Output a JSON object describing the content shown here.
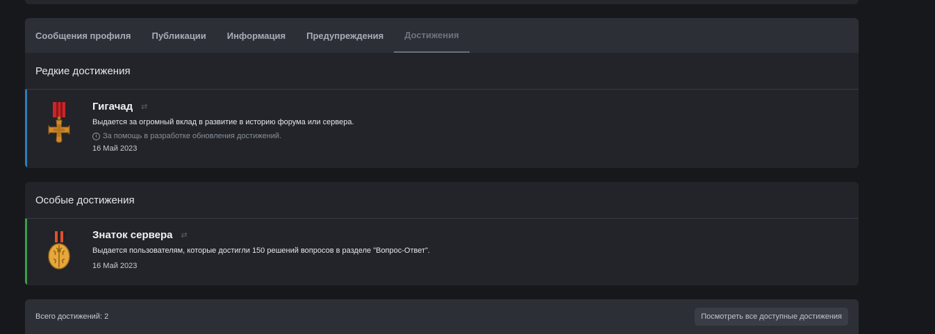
{
  "tabs": [
    {
      "label": "Сообщения профиля",
      "active": false
    },
    {
      "label": "Публикации",
      "active": false
    },
    {
      "label": "Информация",
      "active": false
    },
    {
      "label": "Предупреждения",
      "active": false
    },
    {
      "label": "Достижения",
      "active": true
    }
  ],
  "sections": [
    {
      "title": "Редкие достижения",
      "accent_color": "#2b7fb8",
      "achievement": {
        "icon": "medal-cross-icon",
        "title": "Гигачад",
        "description": "Выдается за огромный вклад в развитие в историю форума или сервера.",
        "note": "За помощь в разработке обновления достижений.",
        "date": "16 Май 2023"
      }
    },
    {
      "title": "Особые достижения",
      "accent_color": "#3aa04a",
      "achievement": {
        "icon": "medal-brain-icon",
        "title": "Знаток сервера",
        "description": "Выдается пользователям, которые достигли 150 решений вопросов в разделе \"Вопрос-Ответ\".",
        "date": "16 Май 2023"
      }
    }
  ],
  "footer": {
    "count_text": "Всего достижений: 2",
    "button_label": "Посмотреть все доступные достижения"
  }
}
